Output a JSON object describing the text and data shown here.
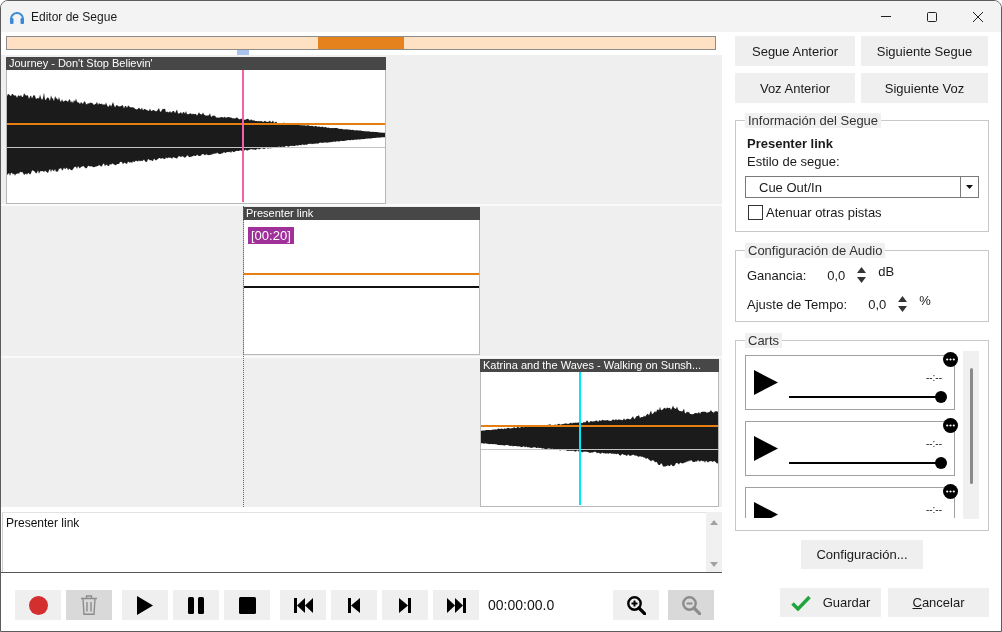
{
  "window": {
    "title": "Editor de Segue"
  },
  "timeline": {
    "lanes": [
      {
        "clip": {
          "title": "Journey - Don't Stop Believin'",
          "kind": "fade-out",
          "marker": {
            "color": "#f062a8"
          }
        }
      },
      {
        "clip": {
          "title": "Presenter link",
          "kind": "flat",
          "tag": "[00:20]"
        }
      },
      {
        "clip": {
          "title": "Katrina and the Waves - Walking on Sunsh...",
          "kind": "fade-in",
          "marker": {
            "color": "#00e8f8"
          }
        }
      }
    ]
  },
  "notes": {
    "value": "Presenter link"
  },
  "transport": {
    "buttons": [
      {
        "kind": "record",
        "disabled": false
      },
      {
        "kind": "delete",
        "disabled": true
      },
      {
        "kind": "play",
        "disabled": false
      },
      {
        "kind": "pause",
        "disabled": false
      },
      {
        "kind": "stop",
        "disabled": false
      },
      {
        "kind": "skip-start",
        "disabled": false
      },
      {
        "kind": "previous",
        "disabled": false
      },
      {
        "kind": "next",
        "disabled": false
      },
      {
        "kind": "skip-end",
        "disabled": false
      }
    ],
    "time": "00:00:00.0",
    "zoom_buttons": [
      {
        "kind": "zoom-in",
        "disabled": false
      },
      {
        "kind": "zoom-out",
        "disabled": true
      }
    ]
  },
  "navigation": [
    "Segue Anterior",
    "Siguiente Segue",
    "Voz Anterior",
    "Siguiente Voz"
  ],
  "segue_info": {
    "legend": "Información del Segue",
    "name": "Presenter link",
    "style_label": "Estilo de segue:",
    "style": {
      "value": "Cue Out/In"
    },
    "dim_other": {
      "label": "Atenuar otras pistas",
      "checked": false
    }
  },
  "audio": {
    "legend": "Configuración de Audio",
    "fields": [
      {
        "label": "Ganancia:",
        "value": "0,0",
        "unit": "dB"
      },
      {
        "label": "Ajuste de Tempo:",
        "value": "0,0",
        "unit": "%"
      }
    ]
  },
  "carts": {
    "legend": "Carts",
    "items": [
      {
        "time": "--:--",
        "level": 1
      },
      {
        "time": "--:--",
        "level": 1
      },
      {
        "time": "--:--"
      }
    ]
  },
  "settings_button": "Configuración...",
  "footer": [
    {
      "kind": "save",
      "label": "Guardar",
      "mnemonic": false
    },
    {
      "kind": "cancel",
      "label": "Cancelar",
      "mnemonic": true
    }
  ]
}
